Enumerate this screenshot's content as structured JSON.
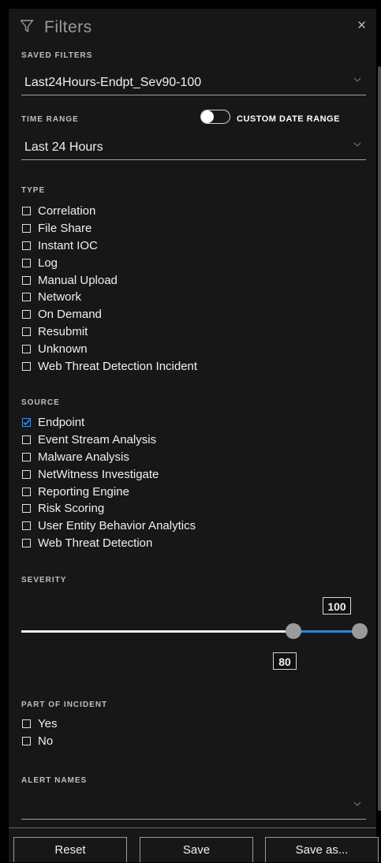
{
  "header": {
    "title": "Filters",
    "close_label": "×"
  },
  "saved_filters": {
    "label": "SAVED FILTERS",
    "value": "Last24Hours-Endpt_Sev90-100"
  },
  "time_range": {
    "label": "TIME RANGE",
    "custom_toggle_label": "CUSTOM DATE RANGE",
    "custom_toggle_on": false,
    "value": "Last 24 Hours"
  },
  "type": {
    "label": "TYPE",
    "items": [
      {
        "label": "Correlation",
        "checked": false
      },
      {
        "label": "File Share",
        "checked": false
      },
      {
        "label": "Instant IOC",
        "checked": false
      },
      {
        "label": "Log",
        "checked": false
      },
      {
        "label": "Manual Upload",
        "checked": false
      },
      {
        "label": "Network",
        "checked": false
      },
      {
        "label": "On Demand",
        "checked": false
      },
      {
        "label": "Resubmit",
        "checked": false
      },
      {
        "label": "Unknown",
        "checked": false
      },
      {
        "label": "Web Threat Detection Incident",
        "checked": false
      }
    ]
  },
  "source": {
    "label": "SOURCE",
    "items": [
      {
        "label": "Endpoint",
        "checked": true
      },
      {
        "label": "Event Stream Analysis",
        "checked": false
      },
      {
        "label": "Malware Analysis",
        "checked": false
      },
      {
        "label": "NetWitness Investigate",
        "checked": false
      },
      {
        "label": "Reporting Engine",
        "checked": false
      },
      {
        "label": "Risk Scoring",
        "checked": false
      },
      {
        "label": "User Entity Behavior Analytics",
        "checked": false
      },
      {
        "label": "Web Threat Detection",
        "checked": false
      }
    ]
  },
  "severity": {
    "label": "SEVERITY",
    "min": "80",
    "max": "100"
  },
  "part_of_incident": {
    "label": "PART OF INCIDENT",
    "items": [
      {
        "label": "Yes",
        "checked": false
      },
      {
        "label": "No",
        "checked": false
      }
    ]
  },
  "alert_names": {
    "label": "ALERT NAMES",
    "value": ""
  },
  "footer": {
    "reset_label": "Reset",
    "save_label": "Save",
    "save_as_label": "Save as..."
  },
  "colors": {
    "panel_bg": "#171717",
    "accent_blue": "#2f86d8",
    "check_blue": "#3f8fe0"
  }
}
